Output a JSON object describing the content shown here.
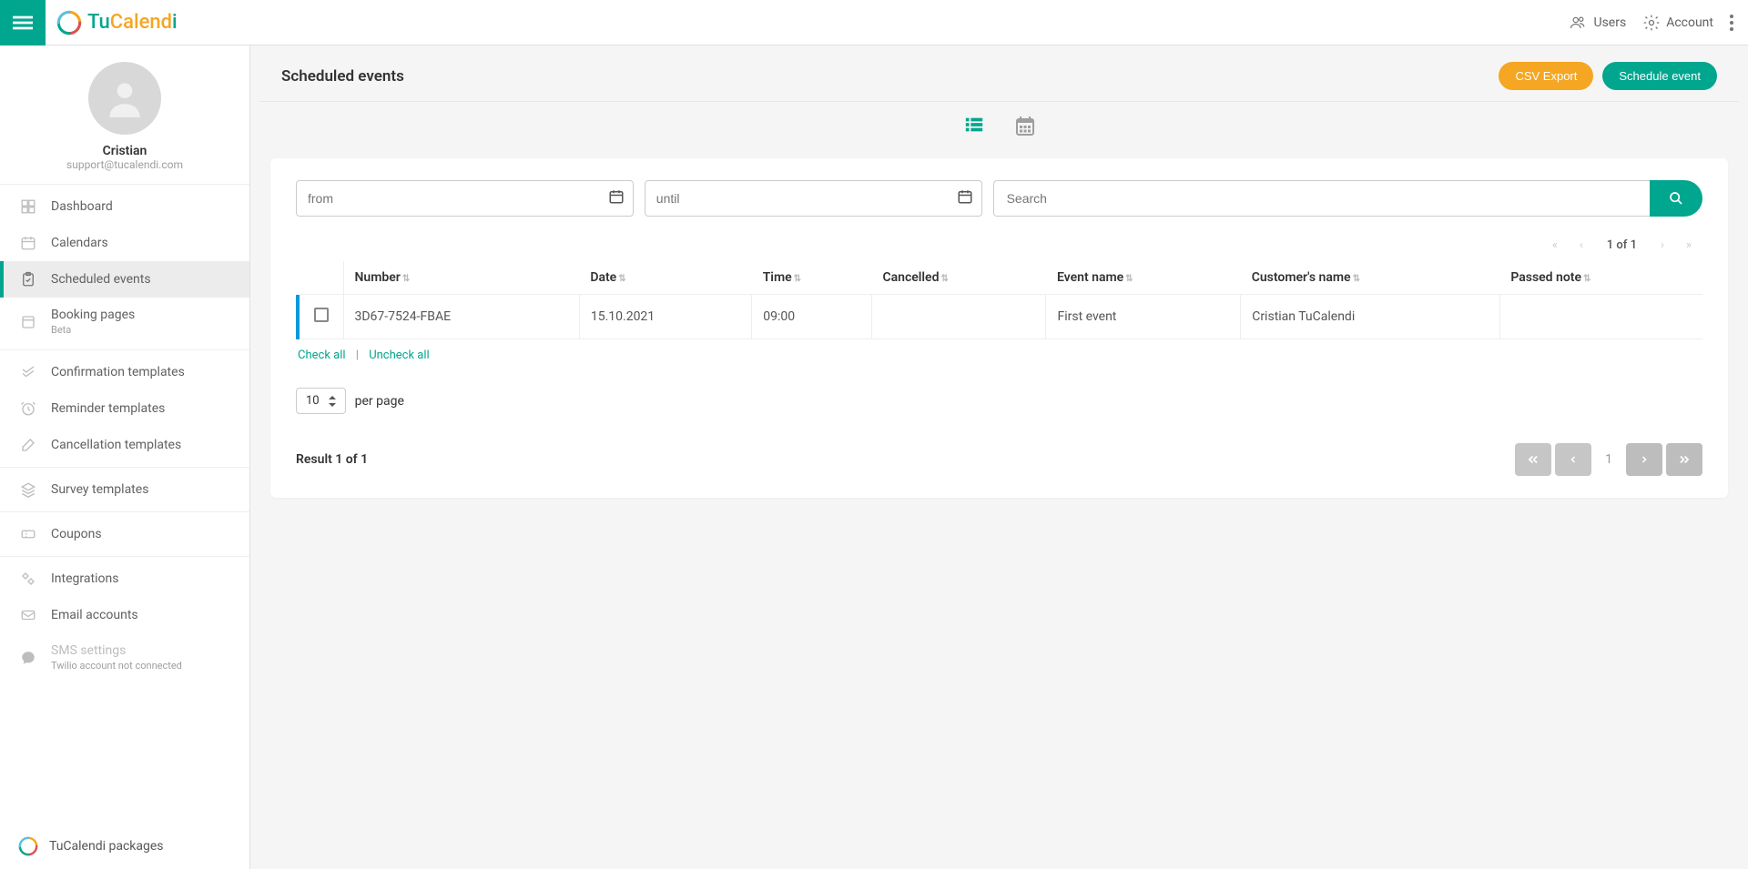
{
  "brand": {
    "name_a": "Tu",
    "name_b": "Calend",
    "name_c": "i"
  },
  "top": {
    "users": "Users",
    "account": "Account"
  },
  "profile": {
    "name": "Cristian",
    "email": "support@tucalendi.com"
  },
  "sidebar": {
    "dashboard": "Dashboard",
    "calendars": "Calendars",
    "scheduled_events": "Scheduled events",
    "booking_pages": "Booking pages",
    "booking_pages_beta": "Beta",
    "confirmation_templates": "Confirmation templates",
    "reminder_templates": "Reminder templates",
    "cancellation_templates": "Cancellation templates",
    "survey_templates": "Survey templates",
    "coupons": "Coupons",
    "integrations": "Integrations",
    "email_accounts": "Email accounts",
    "sms_settings": "SMS settings",
    "sms_sub": "Twilio account not connected",
    "packages": "TuCalendi packages"
  },
  "page": {
    "title": "Scheduled events",
    "csv_export": "CSV Export",
    "schedule_event": "Schedule event"
  },
  "filters": {
    "from_placeholder": "from",
    "until_placeholder": "until",
    "search_placeholder": "Search"
  },
  "pager": {
    "top_label": "1 of 1",
    "result_text": "Result 1 of 1",
    "current_page": "1"
  },
  "table": {
    "headers": {
      "number": "Number",
      "date": "Date",
      "time": "Time",
      "cancelled": "Cancelled",
      "event_name": "Event name",
      "customer_name": "Customer's name",
      "passed_note": "Passed note"
    },
    "rows": [
      {
        "number": "3D67-7524-FBAE",
        "date": "15.10.2021",
        "time": "09:00",
        "cancelled": "",
        "event_name": "First event",
        "customer_name": "Cristian TuCalendi",
        "passed_note": ""
      }
    ]
  },
  "actions": {
    "check_all": "Check all",
    "uncheck_all": "Uncheck all"
  },
  "perpage": {
    "value": "10",
    "label": "per page"
  }
}
